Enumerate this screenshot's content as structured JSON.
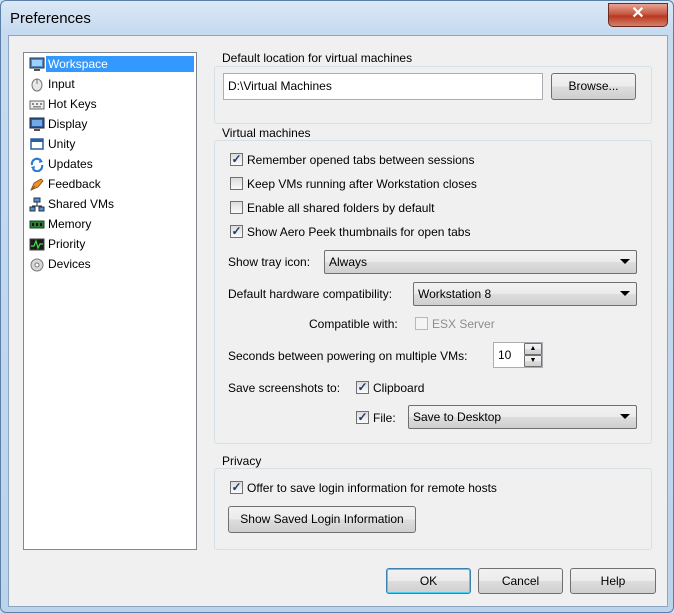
{
  "window": {
    "title": "Preferences",
    "close_glyph": "✕"
  },
  "sidebar": {
    "items": [
      {
        "label": "Workspace",
        "icon": "workspace-icon",
        "selected": true
      },
      {
        "label": "Input",
        "icon": "input-icon"
      },
      {
        "label": "Hot Keys",
        "icon": "keyboard-icon"
      },
      {
        "label": "Display",
        "icon": "display-icon"
      },
      {
        "label": "Unity",
        "icon": "unity-icon"
      },
      {
        "label": "Updates",
        "icon": "updates-icon"
      },
      {
        "label": "Feedback",
        "icon": "feedback-icon"
      },
      {
        "label": "Shared VMs",
        "icon": "shared-vms-icon"
      },
      {
        "label": "Memory",
        "icon": "memory-icon"
      },
      {
        "label": "Priority",
        "icon": "priority-icon"
      },
      {
        "label": "Devices",
        "icon": "devices-icon"
      }
    ]
  },
  "location": {
    "group_label": "Default location for virtual machines",
    "path": "D:\\Virtual Machines",
    "browse_label": "Browse..."
  },
  "vms": {
    "group_label": "Virtual machines",
    "remember_tabs": {
      "label": "Remember opened tabs between sessions",
      "checked": true
    },
    "keep_running": {
      "label": "Keep VMs running after Workstation closes",
      "checked": false
    },
    "enable_shared": {
      "label": "Enable all shared folders by default",
      "checked": false
    },
    "aero_peek": {
      "label": "Show Aero Peek thumbnails for open tabs",
      "checked": true
    },
    "tray_label": "Show tray icon:",
    "tray_value": "Always",
    "hw_label": "Default hardware compatibility:",
    "hw_value": "Workstation 8",
    "compat_label": "Compatible with:",
    "compat_value": "ESX Server",
    "seconds_label": "Seconds between powering on multiple VMs:",
    "seconds_value": "10",
    "save_label": "Save screenshots to:",
    "clipboard_label": "Clipboard",
    "clipboard_checked": true,
    "file_label": "File:",
    "file_checked": true,
    "file_value": "Save to Desktop"
  },
  "privacy": {
    "group_label": "Privacy",
    "offer_save": {
      "label": "Offer to save login information for remote hosts",
      "checked": true
    },
    "show_saved_label": "Show Saved Login Information"
  },
  "footer": {
    "ok": "OK",
    "cancel": "Cancel",
    "help": "Help"
  },
  "colors": {
    "selection": "#3399ff",
    "check": "#1d3b6b"
  }
}
